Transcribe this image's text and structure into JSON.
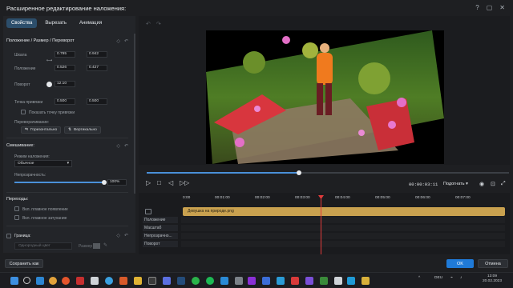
{
  "window": {
    "title": "Расширенное редактирование наложения:"
  },
  "tabs": [
    {
      "label": "Свойства"
    },
    {
      "label": "Вырезать"
    },
    {
      "label": "Анимация"
    }
  ],
  "position_section": {
    "title": "Положение / Размер / Переворот",
    "scale": {
      "label": "Шкала",
      "x": "0.795",
      "y": "0.942"
    },
    "position": {
      "label": "Положение",
      "x": "0.526",
      "y": "0.427"
    },
    "rotation": {
      "label": "Поворот",
      "value": "12.10"
    },
    "anchor": {
      "label": "Точка привязки",
      "x": "0.500",
      "y": "0.500"
    },
    "show_anchor": "Показать точку привязки",
    "flip_label": "Переворачивание:",
    "flip_h": "Горизонтально",
    "flip_v": "Вертикально"
  },
  "blend_section": {
    "title": "Смешивание:",
    "mode_label": "Режим наложения:",
    "mode_value": "Обычное",
    "opacity_label": "Непрозрачность:",
    "opacity_value": "100%",
    "opacity_fraction": 1.0
  },
  "transitions_section": {
    "title": "Переходы:",
    "fade_in": "Вкл. плавное появление",
    "fade_out": "Вкл. плавное затухание"
  },
  "border_section": {
    "title": "Граница:",
    "color_placeholder": "Однородный цвет",
    "size_label": "Размер"
  },
  "player": {
    "timecode": "00:00:03:11",
    "fit": "Подогнать"
  },
  "seek_fraction": 0.42,
  "timeline": {
    "ruler": [
      "0:00",
      "00:01:00",
      "00:02:00",
      "00:03:00",
      "00:04:00",
      "00:05:00",
      "00:06:00",
      "00:07:00"
    ],
    "clip_name": "Девушка на природе.png",
    "tracks": [
      "Положение",
      "Масштаб",
      "Непрозрачно...",
      "Поворот"
    ]
  },
  "footer": {
    "save_as": "Сохранить как",
    "ok": "OK",
    "cancel": "Отмена"
  },
  "taskbar": {
    "lang": "DEU",
    "time": "13:09",
    "date": "20.02.2023"
  },
  "colors": {
    "accent": "#1f7ad8",
    "clip": "#c9a14f",
    "playhead": "#e23b3b"
  }
}
